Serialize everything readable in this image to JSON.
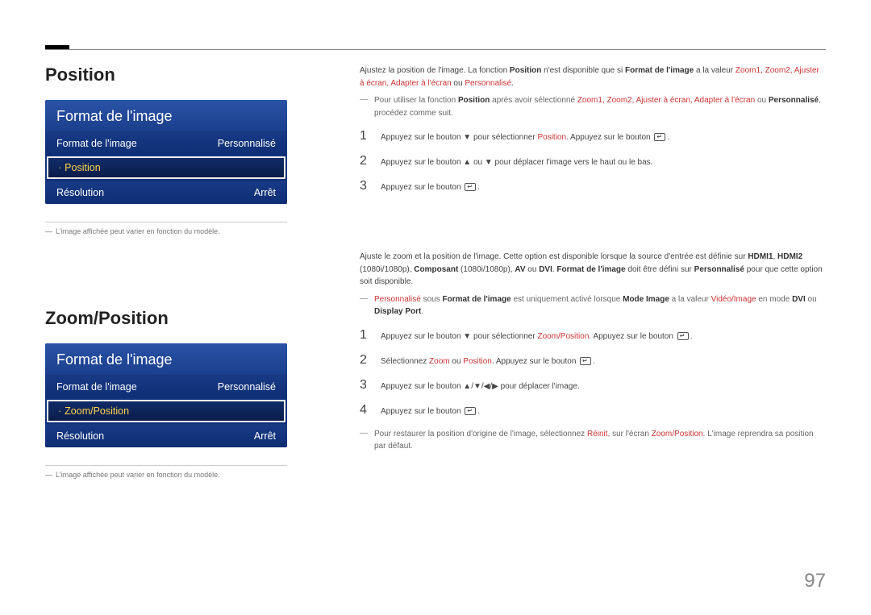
{
  "pageNumber": "97",
  "section1": {
    "title": "Position",
    "menu": {
      "header": "Format de l'image",
      "rows": [
        {
          "label": "Format de l'image",
          "value": "Personnalisé",
          "selected": false
        },
        {
          "label": "Position",
          "value": "",
          "selected": true
        },
        {
          "label": "Résolution",
          "value": "Arrêt",
          "selected": false
        }
      ]
    },
    "note": "L'image affichée peut varier en fonction du modèle.",
    "intro_pre": "Ajustez la position de l'image. La fonction ",
    "intro_b1": "Position",
    "intro_mid": " n'est disponible que si ",
    "intro_b2": "Format de l'image",
    "intro_mid2": " a la valeur ",
    "intro_list": "Zoom1, Zoom2, Ajuster à écran, Adapter à l'écran",
    "intro_or": " ou ",
    "intro_last": "Personnalisé",
    "intro_end": ".",
    "tip_pre": "Pour utiliser la fonction ",
    "tip_b1": "Position",
    "tip_mid": " après avoir sélectionné ",
    "tip_list": "Zoom1, Zoom2, Ajuster à écran, Adapter à l'écran",
    "tip_or": " ou ",
    "tip_last": "Personnalisé",
    "tip_end": ", procédez comme suit.",
    "step1_a": "Appuyez sur le bouton ▼ pour sélectionner ",
    "step1_b": "Position",
    "step1_c": ". Appuyez sur le bouton ",
    "step1_d": ".",
    "step2": "Appuyez sur le bouton ▲ ou ▼ pour déplacer l'image vers le haut ou le bas.",
    "step3_a": "Appuyez sur le bouton ",
    "step3_b": "."
  },
  "section2": {
    "title": "Zoom/Position",
    "menu": {
      "header": "Format de l'image",
      "rows": [
        {
          "label": "Format de l'image",
          "value": "Personnalisé",
          "selected": false
        },
        {
          "label": "Zoom/Position",
          "value": "",
          "selected": true
        },
        {
          "label": "Résolution",
          "value": "Arrêt",
          "selected": false
        }
      ]
    },
    "note": "L'image affichée peut varier en fonction du modèle.",
    "intro_a": "Ajuste le zoom et la position de l'image. Cette option est disponible lorsque la source d'entrée est définie sur ",
    "intro_h1": "HDMI1",
    "intro_c1": ", ",
    "intro_h2": "HDMI2",
    "intro_b": " (1080i/1080p), ",
    "intro_comp": "Composant",
    "intro_c": " (1080i/1080p), ",
    "intro_av": "AV",
    "intro_or1": " ou ",
    "intro_dvi": "DVI",
    "intro_d": ". ",
    "intro_fdi": "Format de l'image",
    "intro_e": " doit être défini sur ",
    "intro_pers": "Personnalisé",
    "intro_f": " pour que cette option soit disponible.",
    "tip_a": "",
    "tip_pers": "Personnalisé",
    "tip_b": " sous ",
    "tip_fdi": "Format de l'image",
    "tip_c": " est uniquement activé lorsque ",
    "tip_mi": "Mode Image",
    "tip_d": " a la valeur ",
    "tip_vi": "Vidéo/Image",
    "tip_e": " en mode ",
    "tip_dvi": "DVI",
    "tip_f": " ou ",
    "tip_dp": "Display Port",
    "tip_g": ".",
    "step1_a": "Appuyez sur le bouton ▼ pour sélectionner ",
    "step1_b": "Zoom/Position",
    "step1_c": ". Appuyez sur le bouton ",
    "step1_d": ".",
    "step2_a": "Sélectionnez ",
    "step2_z": "Zoom",
    "step2_or": " ou ",
    "step2_p": "Position",
    "step2_b": ". Appuyez sur le bouton ",
    "step2_c": ".",
    "step3": "Appuyez sur le bouton ▲/▼/◀/▶ pour déplacer l'image.",
    "step4_a": "Appuyez sur le bouton ",
    "step4_b": ".",
    "tip2_a": "Pour restaurer la position d'origine de l'image, sélectionnez ",
    "tip2_r": "Réinit.",
    "tip2_b": " sur l'écran ",
    "tip2_zp": "Zoom/Position",
    "tip2_c": ". L'image reprendra sa position par défaut."
  }
}
